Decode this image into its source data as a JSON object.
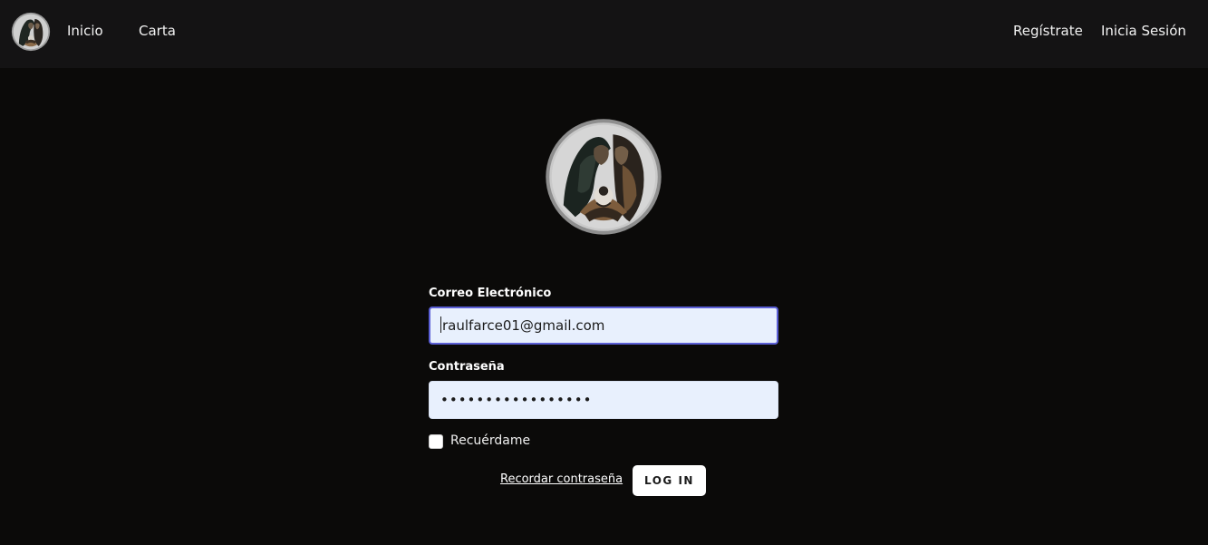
{
  "nav": {
    "logo_icon": "holy-family-logo",
    "left_links": [
      {
        "label": "Inicio"
      },
      {
        "label": "Carta"
      }
    ],
    "right_links": [
      {
        "label": "Regístrate"
      },
      {
        "label": "Inicia Sesión"
      }
    ]
  },
  "login_form": {
    "email": {
      "label": "Correo Electrónico",
      "value": "raulfarce01@gmail.com"
    },
    "password": {
      "label": "Contraseña",
      "masked_value": "•••••••••••••••••"
    },
    "remember_me": {
      "label": "Recuérdame",
      "checked": false
    },
    "forgot_password_label": "Recordar contraseña",
    "submit_label": "LOG IN"
  },
  "colors": {
    "page_background": "#0b0a09",
    "nav_background": "#141314",
    "input_background": "#e8f0fd",
    "focus_border": "#5b5fd6"
  }
}
